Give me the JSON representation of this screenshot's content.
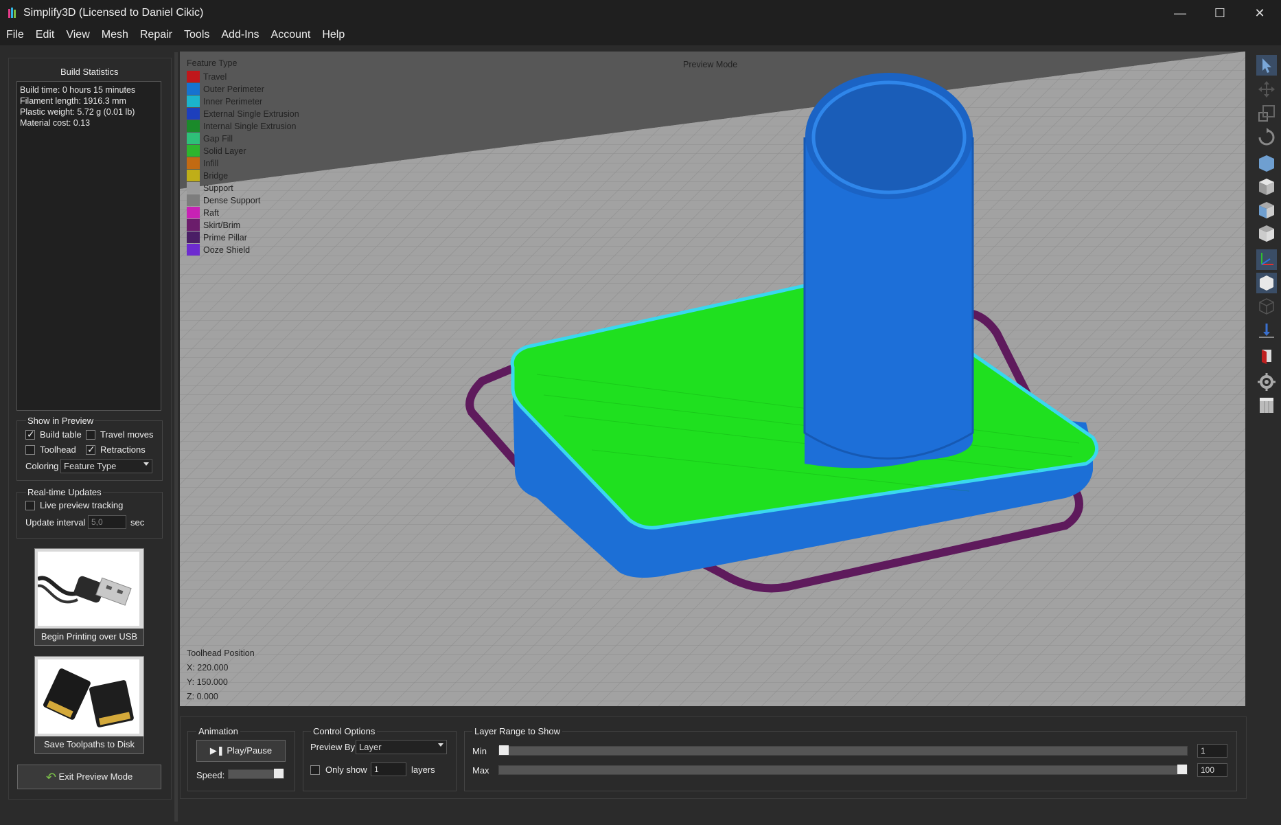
{
  "window": {
    "title": "Simplify3D (Licensed to Daniel Cikic)",
    "minimize": "—",
    "maximize": "☐",
    "close": "✕"
  },
  "menu": [
    "File",
    "Edit",
    "View",
    "Mesh",
    "Repair",
    "Tools",
    "Add-Ins",
    "Account",
    "Help"
  ],
  "build_statistics": {
    "title": "Build Statistics",
    "lines": [
      "Build time: 0 hours 15 minutes",
      "Filament length: 1916.3 mm",
      "Plastic weight: 5.72 g (0.01 lb)",
      "Material cost: 0.13"
    ]
  },
  "show_in_preview": {
    "title": "Show in Preview",
    "build_table": {
      "label": "Build table",
      "checked": true
    },
    "travel_moves": {
      "label": "Travel moves",
      "checked": false
    },
    "toolhead": {
      "label": "Toolhead",
      "checked": false
    },
    "retractions": {
      "label": "Retractions",
      "checked": true
    },
    "coloring_label": "Coloring",
    "coloring_value": "Feature Type"
  },
  "realtime_updates": {
    "title": "Real-time Updates",
    "live_tracking": {
      "label": "Live preview tracking",
      "checked": false
    },
    "interval_label": "Update interval",
    "interval_value": "5,0",
    "interval_unit": "sec"
  },
  "buttons": {
    "usb": "Begin Printing over USB",
    "disk": "Save Toolpaths to Disk",
    "exit": "Exit Preview Mode"
  },
  "viewport": {
    "mode_label": "Preview Mode",
    "legend_title": "Feature Type",
    "legend": [
      {
        "name": "Travel",
        "color": "#c0171b"
      },
      {
        "name": "Outer Perimeter",
        "color": "#1673d0"
      },
      {
        "name": "Inner Perimeter",
        "color": "#1bb3cc"
      },
      {
        "name": "External Single Extrusion",
        "color": "#1d3fbd"
      },
      {
        "name": "Internal Single Extrusion",
        "color": "#1a8a2a"
      },
      {
        "name": "Gap Fill",
        "color": "#2ec079"
      },
      {
        "name": "Solid Layer",
        "color": "#2db52d"
      },
      {
        "name": "Infill",
        "color": "#c26a12"
      },
      {
        "name": "Bridge",
        "color": "#bfae18"
      },
      {
        "name": "Support",
        "color": "#9a9a9a"
      },
      {
        "name": "Dense Support",
        "color": "#7d7d7d"
      },
      {
        "name": "Raft",
        "color": "#c821b5"
      },
      {
        "name": "Skirt/Brim",
        "color": "#6b1d6b"
      },
      {
        "name": "Prime Pillar",
        "color": "#4a1e66"
      },
      {
        "name": "Ooze Shield",
        "color": "#6d2bd0"
      }
    ],
    "toolhead_title": "Toolhead Position",
    "toolhead_x": "X: 220.000",
    "toolhead_y": "Y: 150.000",
    "toolhead_z": "Z: 0.000"
  },
  "animation": {
    "title": "Animation",
    "play_label": "Play/Pause",
    "speed_label": "Speed:",
    "speed_level": 1.0
  },
  "control_options": {
    "title": "Control Options",
    "preview_by_label": "Preview By",
    "preview_by_value": "Layer",
    "only_show_label": "Only show",
    "only_show_value": "1",
    "only_show_checked": false,
    "layers_label": "layers"
  },
  "layer_range": {
    "title": "Layer Range to Show",
    "min_label": "Min",
    "min_value": "1",
    "max_label": "Max",
    "max_value": "100",
    "min_level": 0.0,
    "max_level": 1.0
  },
  "right_toolbar": [
    "select-icon",
    "move-icon",
    "scale-icon",
    "rotate-icon",
    "view-default-icon",
    "view-top-icon",
    "view-front-icon",
    "view-side-icon",
    "axes-icon",
    "solid-view-icon",
    "wireframe-view-icon",
    "cross-section-icon",
    "gcode-preview-icon",
    "settings-icon",
    "build-volume-icon"
  ]
}
